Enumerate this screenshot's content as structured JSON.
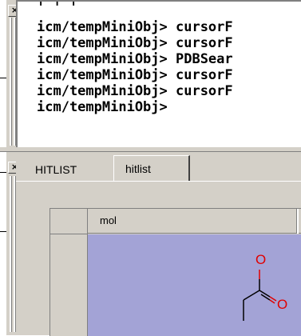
{
  "terminal": {
    "lines": [
      "icm/tempMiniObj> cursorF",
      "icm/tempMiniObj> cursorF",
      "icm/tempMiniObj> PDBSear",
      "icm/tempMiniObj> cursorF",
      "icm/tempMiniObj> cursorF",
      "icm/tempMiniObj>"
    ],
    "close_label": "×"
  },
  "hitlist_panel": {
    "close_label": "×",
    "tabs": [
      {
        "label": "HITLIST",
        "active": false
      },
      {
        "label": "hitlist",
        "active": true
      }
    ],
    "table": {
      "columns": [
        "mol"
      ],
      "cell_color": "#a3a3d6",
      "molecule_atom_label": "O"
    }
  }
}
